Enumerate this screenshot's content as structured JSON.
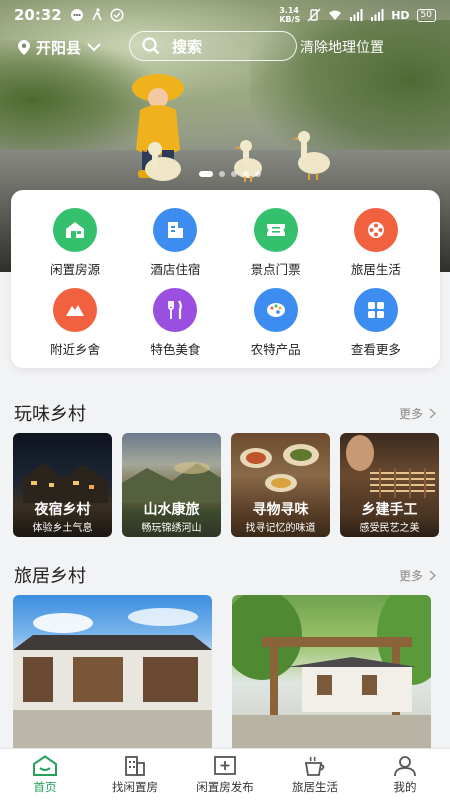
{
  "statusbar": {
    "time": "20:32",
    "net_speed_top": "3.14",
    "net_speed_unit": "KB/S",
    "hd_label": "HD",
    "battery": "50"
  },
  "location": {
    "city": "开阳县"
  },
  "search": {
    "placeholder": "搜索",
    "clear_geo": "清除地理位置"
  },
  "banner": {
    "dot_count": 5,
    "active_dot": 0
  },
  "categories": [
    {
      "label": "闲置房源",
      "icon": "house-icon",
      "color": "#35c06e"
    },
    {
      "label": "酒店住宿",
      "icon": "hotel-icon",
      "color": "#3d8df0"
    },
    {
      "label": "景点门票",
      "icon": "ticket-icon",
      "color": "#35c06e"
    },
    {
      "label": "旅居生活",
      "icon": "film-reel-icon",
      "color": "#f2613f"
    },
    {
      "label": "附近乡舍",
      "icon": "mountain-icon",
      "color": "#f2613f"
    },
    {
      "label": "特色美食",
      "icon": "fork-knife-icon",
      "color": "#9b4fe0"
    },
    {
      "label": "农特产品",
      "icon": "palette-icon",
      "color": "#3d8df0"
    },
    {
      "label": "查看更多",
      "icon": "grid-icon",
      "color": "#3d8df0"
    }
  ],
  "play_section": {
    "title": "玩味乡村",
    "more": "更多",
    "cards": [
      {
        "title": "夜宿乡村",
        "subtitle": "体验乡土气息"
      },
      {
        "title": "山水康旅",
        "subtitle": "畅玩锦绣河山"
      },
      {
        "title": "寻物寻味",
        "subtitle": "找寻记忆的味道"
      },
      {
        "title": "乡建手工",
        "subtitle": "感受民艺之美"
      }
    ]
  },
  "stay_section": {
    "title": "旅居乡村",
    "more": "更多"
  },
  "tabbar": {
    "tabs": [
      {
        "label": "首页",
        "icon": "home-icon",
        "active": true
      },
      {
        "label": "找闲置房",
        "icon": "building-icon",
        "active": false
      },
      {
        "label": "闲置房发布",
        "icon": "add-square-icon",
        "active": false
      },
      {
        "label": "旅居生活",
        "icon": "cup-icon",
        "active": false
      },
      {
        "label": "我的",
        "icon": "user-icon",
        "active": false
      }
    ]
  },
  "colors": {
    "accent": "#27a05a",
    "background": "#f2f3f5"
  }
}
